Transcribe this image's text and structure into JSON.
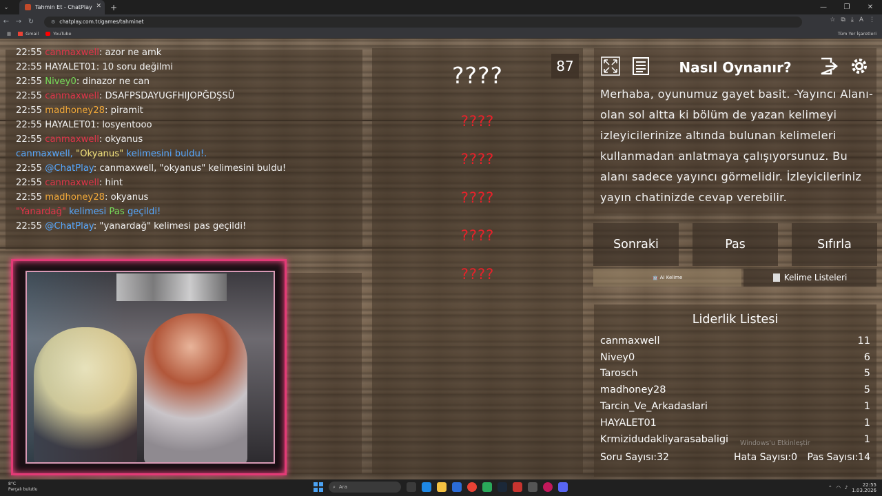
{
  "browser": {
    "tab_title": "Tahmin Et - ChatPlay",
    "url": "chatplay.com.tr/games/tahminet",
    "bookmarks": [
      "Gmail",
      "YouTube"
    ],
    "bookmarks_right": "Tüm Yer İşaretleri",
    "profile_initial": "A"
  },
  "chat": {
    "lines": [
      {
        "time": "22:55",
        "user": "canmaxwell",
        "user_color": "red",
        "msg": ": azor ne amk"
      },
      {
        "time": "22:55",
        "user": "HAYALET01",
        "user_color": "white",
        "msg": ": 10 soru değilmi"
      },
      {
        "time": "22:55",
        "user": "Nivey0",
        "user_color": "green",
        "msg": ": dinazor ne can"
      },
      {
        "time": "22:55",
        "user": "canmaxwell",
        "user_color": "red",
        "msg": ": DSAFPSDAYUGFHIJOPĞDŞSÜ"
      },
      {
        "time": "22:55",
        "user": "madhoney28",
        "user_color": "orange",
        "msg": ": piramit"
      },
      {
        "time": "22:55",
        "user": "HAYALET01",
        "user_color": "white",
        "msg": ": losyentooo"
      },
      {
        "time": "22:55",
        "user": "canmaxwell",
        "user_color": "red",
        "msg": ": okyanus"
      }
    ],
    "found_user": "canmaxwell,",
    "found_word": "\"Okyanus\"",
    "found_suffix": "kelimesini buldu!.",
    "bot_line1_time": "22:55",
    "bot_line1_user": "@ChatPlay",
    "bot_line1_msg": ": canmaxwell, \"okyanus\" kelimesini buldu!",
    "line_hint_time": "22:55",
    "line_hint_user": "canmaxwell",
    "line_hint_msg": ": hint",
    "line_ok_time": "22:55",
    "line_ok_user": "madhoney28",
    "line_ok_msg": ": okyanus",
    "pass_word": "\"Yanardağ\"",
    "pass_mid": "kelimesi",
    "pass_label": "Pas",
    "pass_suffix": "geçildi!",
    "bot_line2_time": "22:55",
    "bot_line2_user": "@ChatPlay",
    "bot_line2_msg": ": \"yanardağ\" kelimesi pas geçildi!"
  },
  "game": {
    "main_word": "????",
    "counter": "87",
    "forbidden_words": [
      "????",
      "????",
      "????",
      "????",
      "????"
    ]
  },
  "info": {
    "title": "Nasıl Oynanır?",
    "text": "Merhaba, oyunumuz gayet basit. -Yayıncı Alanı- olan sol altta ki bölüm de yazan kelimeyi izleyicilerinize altında bulunan kelimeleri kullanmadan anlatmaya çalışıyorsunuz. Bu alanı sadece yayıncı görmelidir. İzleyicileriniz yayın chatinizde cevap verebilir.",
    "icons": [
      "fullscreen-icon",
      "list-icon",
      "logout-icon",
      "gear-icon"
    ]
  },
  "controls": {
    "next": "Sonraki",
    "pass": "Pas",
    "reset": "Sıfırla",
    "ai_word": "AI Kelime",
    "word_lists": "Kelime Listeleri"
  },
  "leaderboard": {
    "title": "Liderlik Listesi",
    "rows": [
      {
        "name": "canmaxwell",
        "score": "11"
      },
      {
        "name": "Nivey0",
        "score": "6"
      },
      {
        "name": "Tarosch",
        "score": "5"
      },
      {
        "name": "madhoney28",
        "score": "5"
      },
      {
        "name": "Tarcin_Ve_Arkadaslari",
        "score": "1"
      },
      {
        "name": "HAYALET01",
        "score": "1"
      },
      {
        "name": "Krmizidudakliyarasabaligi",
        "score": "1"
      }
    ],
    "question_count": "Soru Sayısı:32",
    "error_count": "Hata Sayısı:0",
    "pass_count": "Pas Sayısı:14",
    "watermark": "Windows'u Etkinleştir"
  },
  "taskbar": {
    "weather_temp": "8°C",
    "weather_desc": "Parçalı bulutlu",
    "search_placeholder": "Ara",
    "time": "22:55",
    "date": "1.03.2026"
  }
}
